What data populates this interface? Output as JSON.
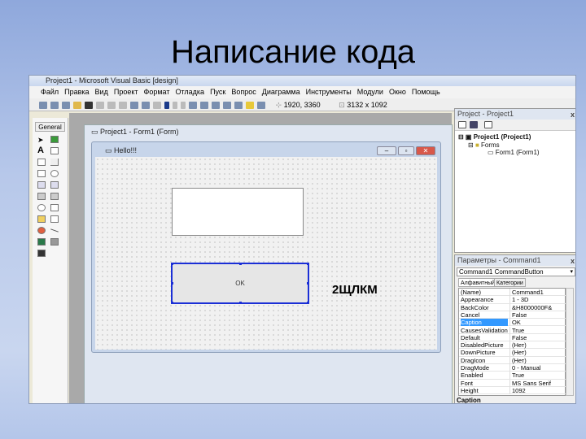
{
  "slide": {
    "title": "Написание кода",
    "annotation": "2ЩЛКМ"
  },
  "ide": {
    "title": "Project1 - Microsoft Visual Basic [design]",
    "menu": [
      "Файл",
      "Правка",
      "Вид",
      "Проект",
      "Формат",
      "Отладка",
      "Пуск",
      "Вопрос",
      "Диаграмма",
      "Инструменты",
      "Модули",
      "Окно",
      "Помощь"
    ],
    "position": "1920, 3360",
    "size": "3132 x 1092"
  },
  "toolbox": {
    "tab": "General"
  },
  "designer": {
    "window_title": "Project1 - Form1 (Form)",
    "form_caption": "Hello!!!",
    "button_caption": "OK"
  },
  "project": {
    "title": "Project - Project1",
    "close": "x",
    "tree": [
      "Project1 (Project1)",
      "Forms",
      "Form1 (Form1)"
    ]
  },
  "properties": {
    "title": "Параметры - Command1",
    "close": "x",
    "object": "Command1 CommandButton",
    "tabs": [
      "Алфавитный",
      "Категории"
    ],
    "rows": [
      [
        "(Name)",
        "Command1"
      ],
      [
        "Appearance",
        "1 - 3D"
      ],
      [
        "BackColor",
        "&H8000000F&"
      ],
      [
        "Cancel",
        "False"
      ],
      [
        "Caption",
        "OK"
      ],
      [
        "CausesValidation",
        "True"
      ],
      [
        "Default",
        "False"
      ],
      [
        "DisabledPicture",
        "(Нет)"
      ],
      [
        "DownPicture",
        "(Нет)"
      ],
      [
        "DragIcon",
        "(Нет)"
      ],
      [
        "DragMode",
        "0 - Manual"
      ],
      [
        "Enabled",
        "True"
      ],
      [
        "Font",
        "MS Sans Serif"
      ],
      [
        "Height",
        "1092"
      ]
    ],
    "selected": "Caption",
    "description": "Caption"
  }
}
